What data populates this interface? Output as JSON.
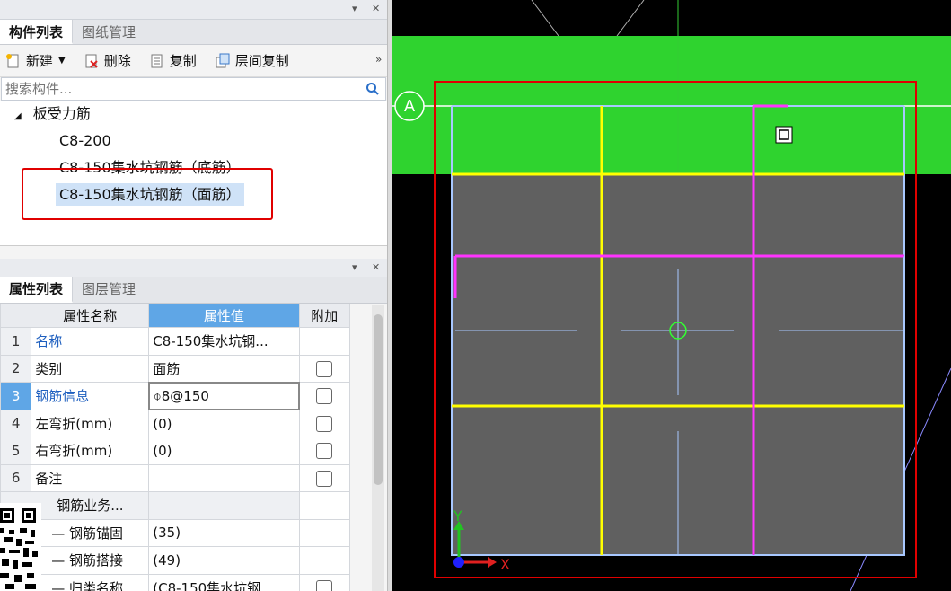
{
  "component_panel": {
    "tabs": [
      "构件列表",
      "图纸管理"
    ],
    "toolbar": {
      "new": "新建",
      "delete": "删除",
      "copy": "复制",
      "floor_copy": "层间复制",
      "more": "»"
    },
    "search_placeholder": "搜索构件...",
    "tree": {
      "group": "板受力筋",
      "items": [
        "C8-200",
        "C8-150集水坑钢筋（底筋）",
        "C8-150集水坑钢筋（面筋）"
      ]
    }
  },
  "property_panel": {
    "tabs": [
      "属性列表",
      "图层管理"
    ],
    "headers": {
      "name": "属性名称",
      "value": "属性值",
      "extra": "附加"
    },
    "rows": [
      {
        "num": "1",
        "name": "名称",
        "value": "C8-150集水坑钢..."
      },
      {
        "num": "2",
        "name": "类别",
        "value": "面筋"
      },
      {
        "num": "3",
        "name": "钢筋信息",
        "value": "⌽8@150"
      },
      {
        "num": "4",
        "name": "左弯折(mm)",
        "value": "(0)"
      },
      {
        "num": "5",
        "name": "右弯折(mm)",
        "value": "(0)"
      },
      {
        "num": "6",
        "name": "备注",
        "value": ""
      }
    ],
    "subgroup": "钢筋业务...",
    "subrows": [
      {
        "name": "钢筋锚固",
        "value": "(35)"
      },
      {
        "name": "钢筋搭接",
        "value": "(49)"
      },
      {
        "name": "归类名称",
        "value": "(C8-150集水坑钢..."
      }
    ]
  },
  "cad": {
    "axis_label": "A",
    "axis_y": "Y",
    "axis_x": "X",
    "colors": {
      "slab": "#2fd32f",
      "pit": "#606060",
      "rebar_yellow": "#ffff00",
      "rebar_magenta": "#ff33ff",
      "highlight": "#e00000"
    }
  }
}
